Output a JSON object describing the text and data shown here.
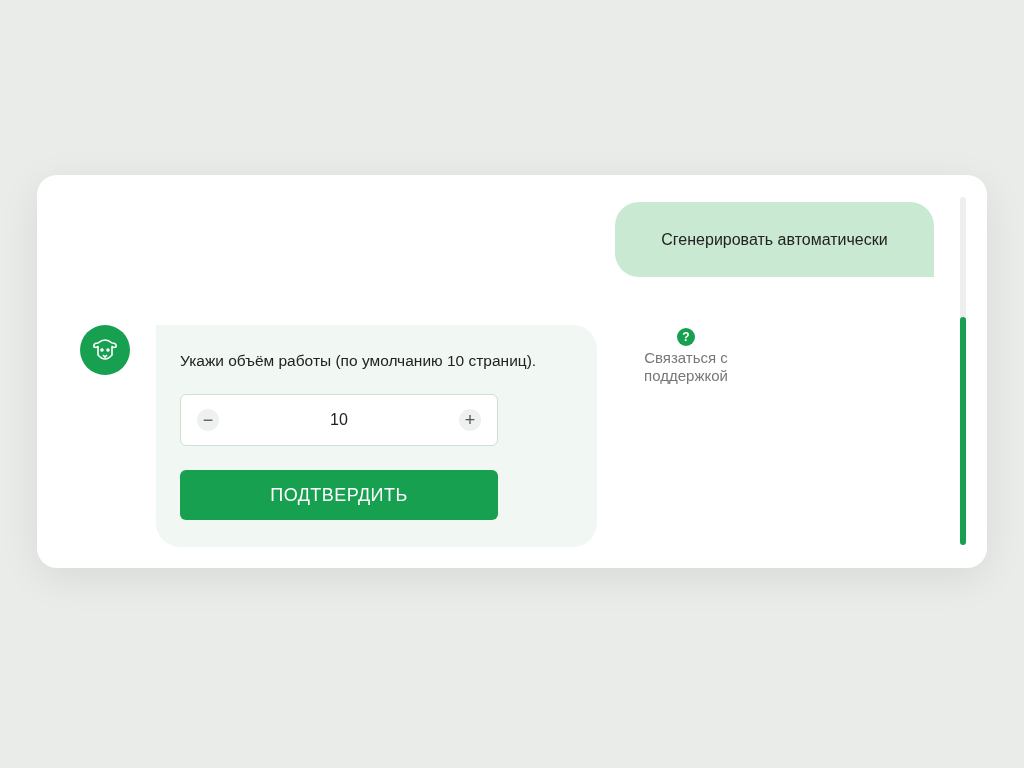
{
  "user_message": {
    "text": "Сгенерировать автоматически"
  },
  "bot_message": {
    "text": "Укажи объём работы (по умолчанию 10 страниц).",
    "stepper": {
      "minus": "−",
      "value": "10",
      "plus": "+"
    },
    "confirm_button": "ПОДТВЕРДИТЬ"
  },
  "support_link": {
    "icon": "?",
    "label": "Связаться с поддержкой"
  }
}
